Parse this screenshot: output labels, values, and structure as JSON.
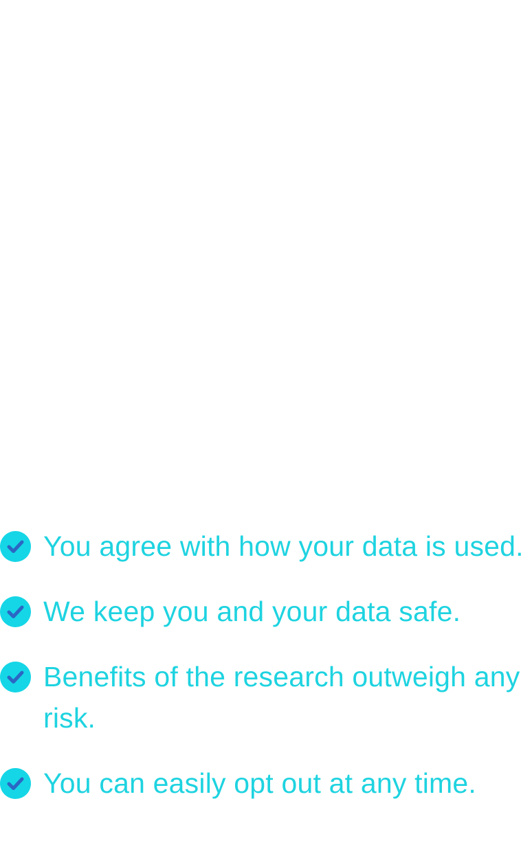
{
  "checklist": {
    "items": [
      {
        "icon": "check-circle-icon",
        "text": "You agree with how your data is used."
      },
      {
        "icon": "check-circle-icon",
        "text": "We keep you and your data safe."
      },
      {
        "icon": "check-circle-icon",
        "text": "Benefits of the research outweigh any risk."
      },
      {
        "icon": "check-circle-icon",
        "text": "You can easily opt out at any time."
      }
    ]
  },
  "colors": {
    "text": "#1ed3e0",
    "icon_background": "#15d6e6",
    "checkmark": "#2b67c4",
    "page_background": "#ffffff"
  }
}
